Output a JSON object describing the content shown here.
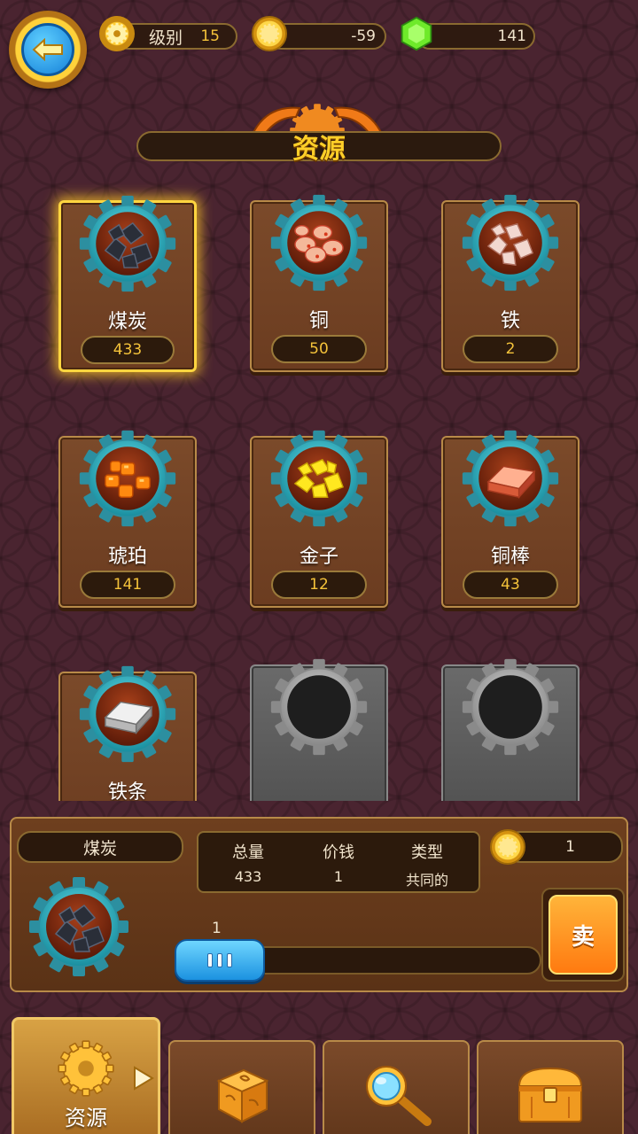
{
  "header": {
    "level_label": "级别",
    "level_value": "15",
    "coins_value": "-59",
    "gems_value": "141"
  },
  "title": "资源",
  "resources": [
    {
      "name": "煤炭",
      "count": "433",
      "icon": "coal-icon"
    },
    {
      "name": "铜",
      "count": "50",
      "icon": "copper-ore-icon"
    },
    {
      "name": "铁",
      "count": "2",
      "icon": "iron-ore-icon"
    },
    {
      "name": "琥珀",
      "count": "141",
      "icon": "amber-icon"
    },
    {
      "name": "金子",
      "count": "12",
      "icon": "gold-ore-icon"
    },
    {
      "name": "铜棒",
      "count": "43",
      "icon": "copper-bar-icon"
    },
    {
      "name": "铁条",
      "count": "",
      "icon": "iron-bar-icon"
    }
  ],
  "detail": {
    "name": "煤炭",
    "total_label": "总量",
    "total_value": "433",
    "price_label": "价钱",
    "price_value": "1",
    "type_label": "类型",
    "type_value": "共同的",
    "sell_price": "1",
    "slider_value": "1",
    "slider_fraction": 0,
    "sell_label": "卖"
  },
  "tabs": [
    {
      "label": "资源",
      "icon": "gear-icon",
      "active": true
    },
    {
      "label": "",
      "icon": "dice-icon"
    },
    {
      "label": "",
      "icon": "magnifier-icon"
    },
    {
      "label": "",
      "icon": "chest-icon"
    }
  ],
  "colors": {
    "background": "#4a2430",
    "accent_gold": "#ffcf28",
    "count_text": "#f5c33a",
    "teal_ring": "#2ec4d0"
  }
}
